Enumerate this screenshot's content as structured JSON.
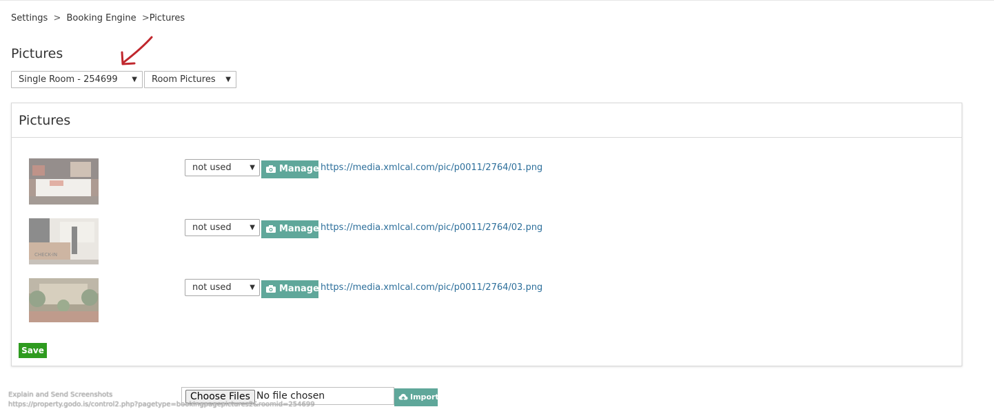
{
  "breadcrumb": {
    "items": [
      "Settings",
      "Booking Engine",
      "Pictures"
    ],
    "separator": ">"
  },
  "page_title": "Pictures",
  "selectors": {
    "room": "Single Room - 254699",
    "picture_type": "Room Pictures"
  },
  "panel": {
    "title": "Pictures",
    "rows": [
      {
        "usage": "not used",
        "manage_label": "Manage",
        "url": "https://media.xmlcal.com/pic/p0011/2764/01.png"
      },
      {
        "usage": "not used",
        "manage_label": "Manage",
        "url": "https://media.xmlcal.com/pic/p0011/2764/02.png"
      },
      {
        "usage": "not used",
        "manage_label": "Manage",
        "url": "https://media.xmlcal.com/pic/p0011/2764/03.png"
      }
    ],
    "save_label": "Save"
  },
  "upload": {
    "choose_label": "Choose Files",
    "no_file_text": "No file chosen",
    "import_label": "Import"
  },
  "overlay": {
    "line1": "Explain and Send Screenshots",
    "line2": "https://property.godo.is/control2.php?pagetype=bookingpagepictures2&roomid=254699"
  },
  "colors": {
    "accent": "#5fa79a",
    "save": "#2e9b1f",
    "link": "#2d6f9b",
    "arrow": "#c0272d"
  },
  "icons": {
    "chevron": "chevron-down-icon",
    "camera": "camera-icon",
    "upload": "cloud-upload-icon",
    "arrow": "red-arrow-annotation"
  }
}
